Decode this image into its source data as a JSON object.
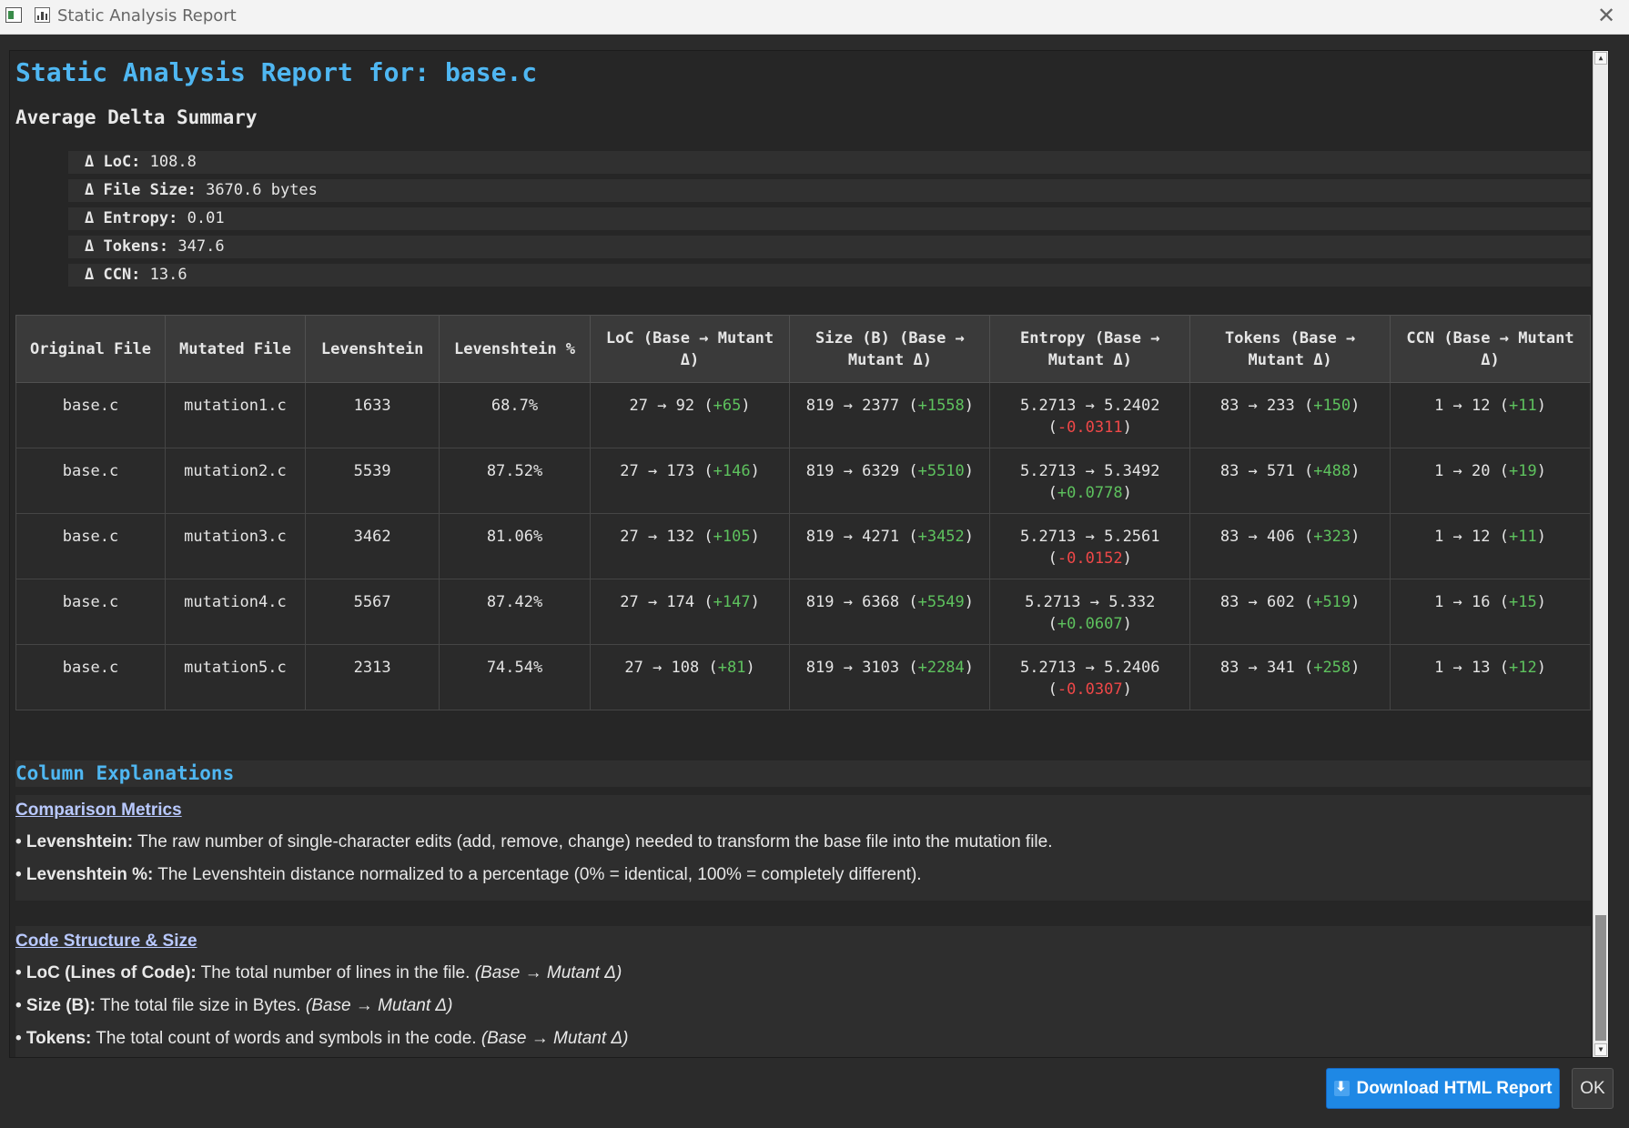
{
  "window": {
    "title": "Static Analysis Report",
    "close_glyph": "✕"
  },
  "report": {
    "title": "Static Analysis Report for: base.c",
    "summary_heading": "Average Delta Summary",
    "summary": [
      {
        "label": "Δ LoC:",
        "value": "108.8"
      },
      {
        "label": "Δ File Size:",
        "value": "3670.6 bytes"
      },
      {
        "label": "Δ Entropy:",
        "value": "0.01"
      },
      {
        "label": "Δ Tokens:",
        "value": "347.6"
      },
      {
        "label": "Δ CCN:",
        "value": "13.6"
      }
    ],
    "table": {
      "headers": [
        "Original File",
        "Mutated File",
        "Levenshtein",
        "Levenshtein %",
        "LoC (Base → Mutant Δ)",
        "Size (B) (Base → Mutant Δ)",
        "Entropy (Base → Mutant Δ)",
        "Tokens (Base → Mutant Δ)",
        "CCN (Base → Mutant Δ)"
      ],
      "rows": [
        {
          "orig": "base.c",
          "mut": "mutation1.c",
          "lev": "1633",
          "levp": "68.7%",
          "loc": "27 → 92",
          "loc_d": "+65",
          "size": "819 → 2377",
          "size_d": "+1558",
          "ent": "5.2713 → 5.2402",
          "ent_d": "-0.0311",
          "tok": "83 → 233",
          "tok_d": "+150",
          "ccn": "1 → 12",
          "ccn_d": "+11"
        },
        {
          "orig": "base.c",
          "mut": "mutation2.c",
          "lev": "5539",
          "levp": "87.52%",
          "loc": "27 → 173",
          "loc_d": "+146",
          "size": "819 → 6329",
          "size_d": "+5510",
          "ent": "5.2713 → 5.3492",
          "ent_d": "+0.0778",
          "tok": "83 → 571",
          "tok_d": "+488",
          "ccn": "1 → 20",
          "ccn_d": "+19"
        },
        {
          "orig": "base.c",
          "mut": "mutation3.c",
          "lev": "3462",
          "levp": "81.06%",
          "loc": "27 → 132",
          "loc_d": "+105",
          "size": "819 → 4271",
          "size_d": "+3452",
          "ent": "5.2713 → 5.2561",
          "ent_d": "-0.0152",
          "tok": "83 → 406",
          "tok_d": "+323",
          "ccn": "1 → 12",
          "ccn_d": "+11"
        },
        {
          "orig": "base.c",
          "mut": "mutation4.c",
          "lev": "5567",
          "levp": "87.42%",
          "loc": "27 → 174",
          "loc_d": "+147",
          "size": "819 → 6368",
          "size_d": "+5549",
          "ent": "5.2713 → 5.332",
          "ent_d": "+0.0607",
          "tok": "83 → 602",
          "tok_d": "+519",
          "ccn": "1 → 16",
          "ccn_d": "+15"
        },
        {
          "orig": "base.c",
          "mut": "mutation5.c",
          "lev": "2313",
          "levp": "74.54%",
          "loc": "27 → 108",
          "loc_d": "+81",
          "size": "819 → 3103",
          "size_d": "+2284",
          "ent": "5.2713 → 5.2406",
          "ent_d": "-0.0307",
          "tok": "83 → 341",
          "tok_d": "+258",
          "ccn": "1 → 13",
          "ccn_d": "+12"
        }
      ]
    },
    "explanations_heading": "Column Explanations",
    "comparison": {
      "heading": "Comparison Metrics",
      "items": [
        {
          "term": "• Levenshtein:",
          "text": " The raw number of single-character edits (add, remove, change) needed to transform the base file into the mutation file."
        },
        {
          "term": "• Levenshtein %:",
          "text": " The Levenshtein distance normalized to a percentage (0% = identical, 100% = completely different)."
        }
      ]
    },
    "structure": {
      "heading": "Code Structure & Size",
      "items": [
        {
          "term": "• LoC (Lines of Code):",
          "text": " The total number of lines in the file. ",
          "note": "(Base → Mutant Δ)"
        },
        {
          "term": "• Size (B):",
          "text": " The total file size in Bytes. ",
          "note": "(Base → Mutant Δ)"
        },
        {
          "term": "• Tokens:",
          "text": " The total count of words and symbols in the code. ",
          "note": "(Base → Mutant Δ)"
        }
      ]
    }
  },
  "footer": {
    "download_label": "Download HTML Report",
    "ok_label": "OK"
  },
  "colors": {
    "accent": "#4fb7f2",
    "positive": "#5ec25e",
    "negative": "#f04848",
    "button": "#1e88e5"
  }
}
